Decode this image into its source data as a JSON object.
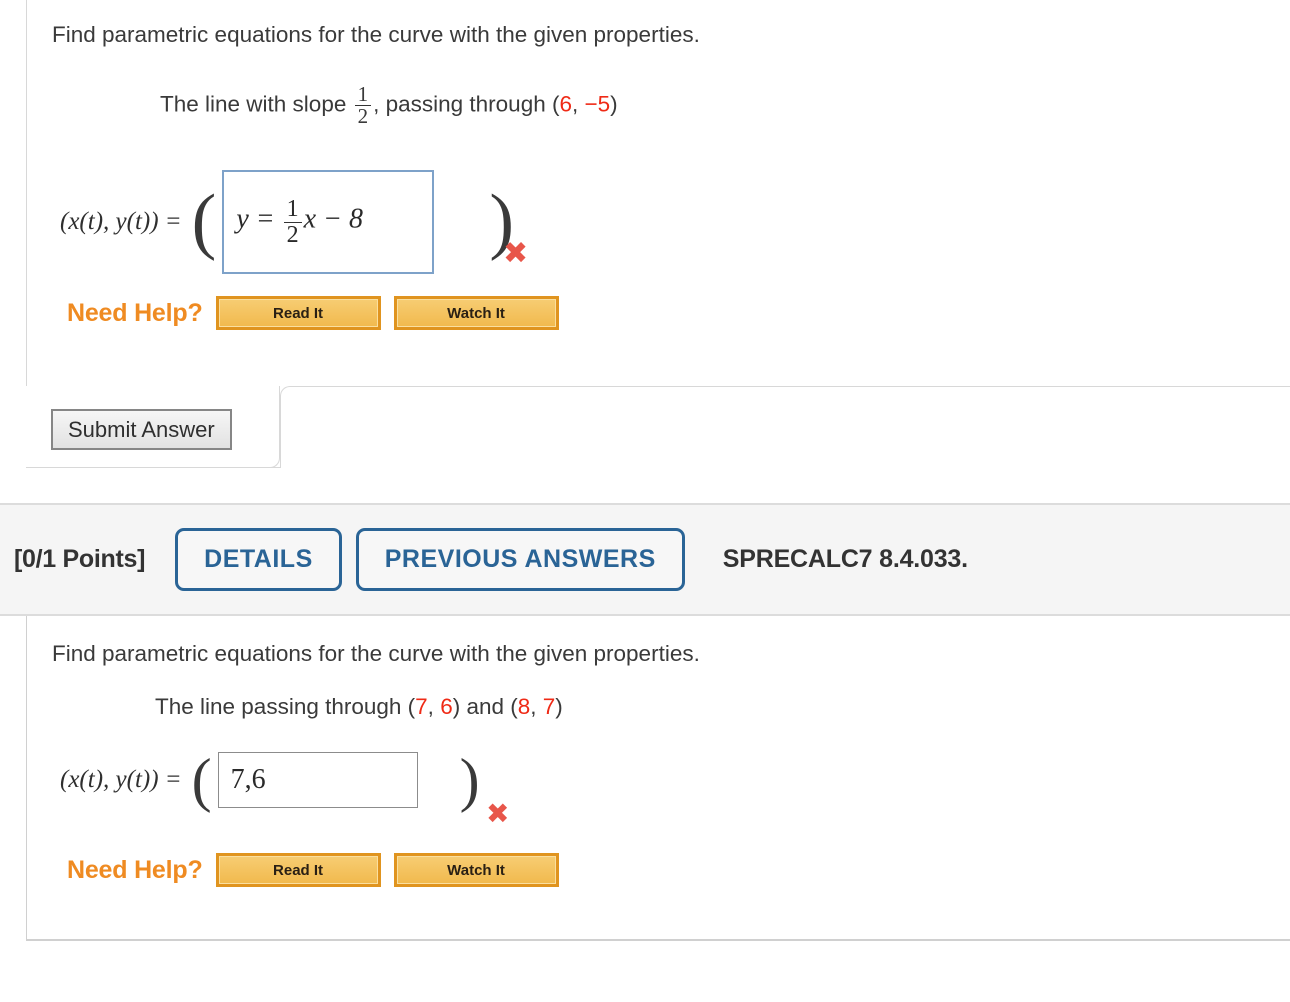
{
  "problem1": {
    "prompt": "Find parametric equations for the curve with the given properties.",
    "subprompt_pre": "The line with slope ",
    "slope_num": "1",
    "slope_den": "2",
    "subprompt_mid": ",  passing through (",
    "point_x": "6",
    "point_sep": ", ",
    "point_y": "−5",
    "subprompt_post": ")",
    "answer_label": "(x(t), y(t)) =",
    "answer_value_pre": "y = ",
    "answer_frac_num": "1",
    "answer_frac_den": "2",
    "answer_value_post": "x − 8",
    "status_icon": "wrong-answer-x",
    "status_glyph": "✖",
    "open_paren": "(",
    "close_paren": ")"
  },
  "problem2": {
    "prompt": "Find parametric equations for the curve with the given properties.",
    "subprompt_pre": "The line passing through (",
    "p1_x": "7",
    "p1_sep": ", ",
    "p1_y": "6",
    "subprompt_mid": ") and (",
    "p2_x": "8",
    "p2_sep": ", ",
    "p2_y": "7",
    "subprompt_post": ")",
    "answer_label": "(x(t), y(t)) =",
    "answer_value": "7,6",
    "status_icon": "wrong-answer-x",
    "status_glyph": "✖",
    "open_paren": "(",
    "close_paren": ")"
  },
  "help": {
    "label": "Need Help?",
    "read_it": "Read It",
    "watch_it": "Watch It"
  },
  "submit": {
    "label": "Submit Answer"
  },
  "section_header": {
    "points": "[0/1 Points]",
    "details": "DETAILS",
    "previous_answers": "PREVIOUS ANSWERS",
    "exercise_code": "SPRECALC7 8.4.033."
  },
  "colors": {
    "red_value": "#ef2a16",
    "help_orange": "#ef8b22",
    "pill_blue": "#2a6496",
    "wrong_x": "#e8564a",
    "input_focus_border": "#7ea2c9"
  }
}
